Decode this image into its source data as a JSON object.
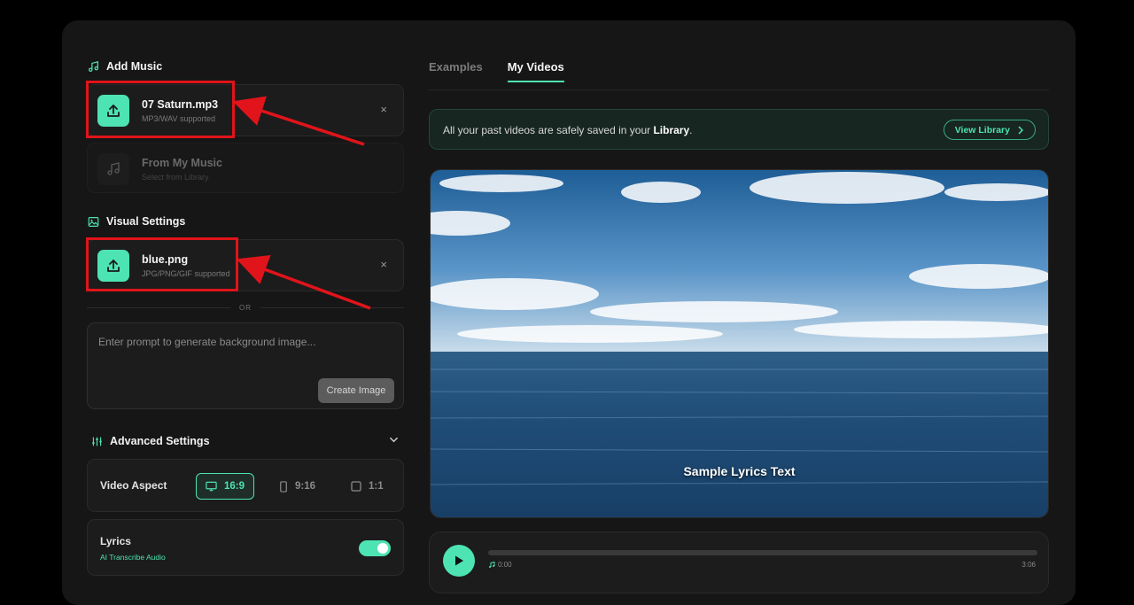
{
  "add_music": {
    "title": "Add Music",
    "file_name": "07 Saturn.mp3",
    "file_hint": "MP3/WAV supported",
    "close_label": "×",
    "library_title": "From My Music",
    "library_sub": "Select from Library"
  },
  "visual_settings": {
    "title": "Visual Settings",
    "file_name": "blue.png",
    "file_hint": "JPG/PNG/GIF supported",
    "close_label": "×",
    "or_label": "OR",
    "prompt_placeholder": "Enter prompt to generate background image...",
    "create_button": "Create Image"
  },
  "advanced": {
    "title": "Advanced Settings",
    "aspect_label": "Video Aspect",
    "aspect_options": [
      "16:9",
      "9:16",
      "1:1"
    ],
    "aspect_selected": "16:9",
    "lyrics_label": "Lyrics",
    "lyrics_sub": "AI Transcribe Audio",
    "lyrics_enabled": true
  },
  "tabs": [
    "Examples",
    "My Videos"
  ],
  "active_tab": "My Videos",
  "banner": {
    "text_prefix": "All your past videos are safely saved in your ",
    "text_bold": "Library",
    "text_suffix": ".",
    "button": "View Library"
  },
  "preview": {
    "lyrics_text": "Sample Lyrics Text"
  },
  "player": {
    "current_time": "0:00",
    "total_time": "3:06",
    "progress": 0
  },
  "colors": {
    "accent": "#4de3b3",
    "annotation": "#e0141a",
    "panel": "#161616"
  }
}
